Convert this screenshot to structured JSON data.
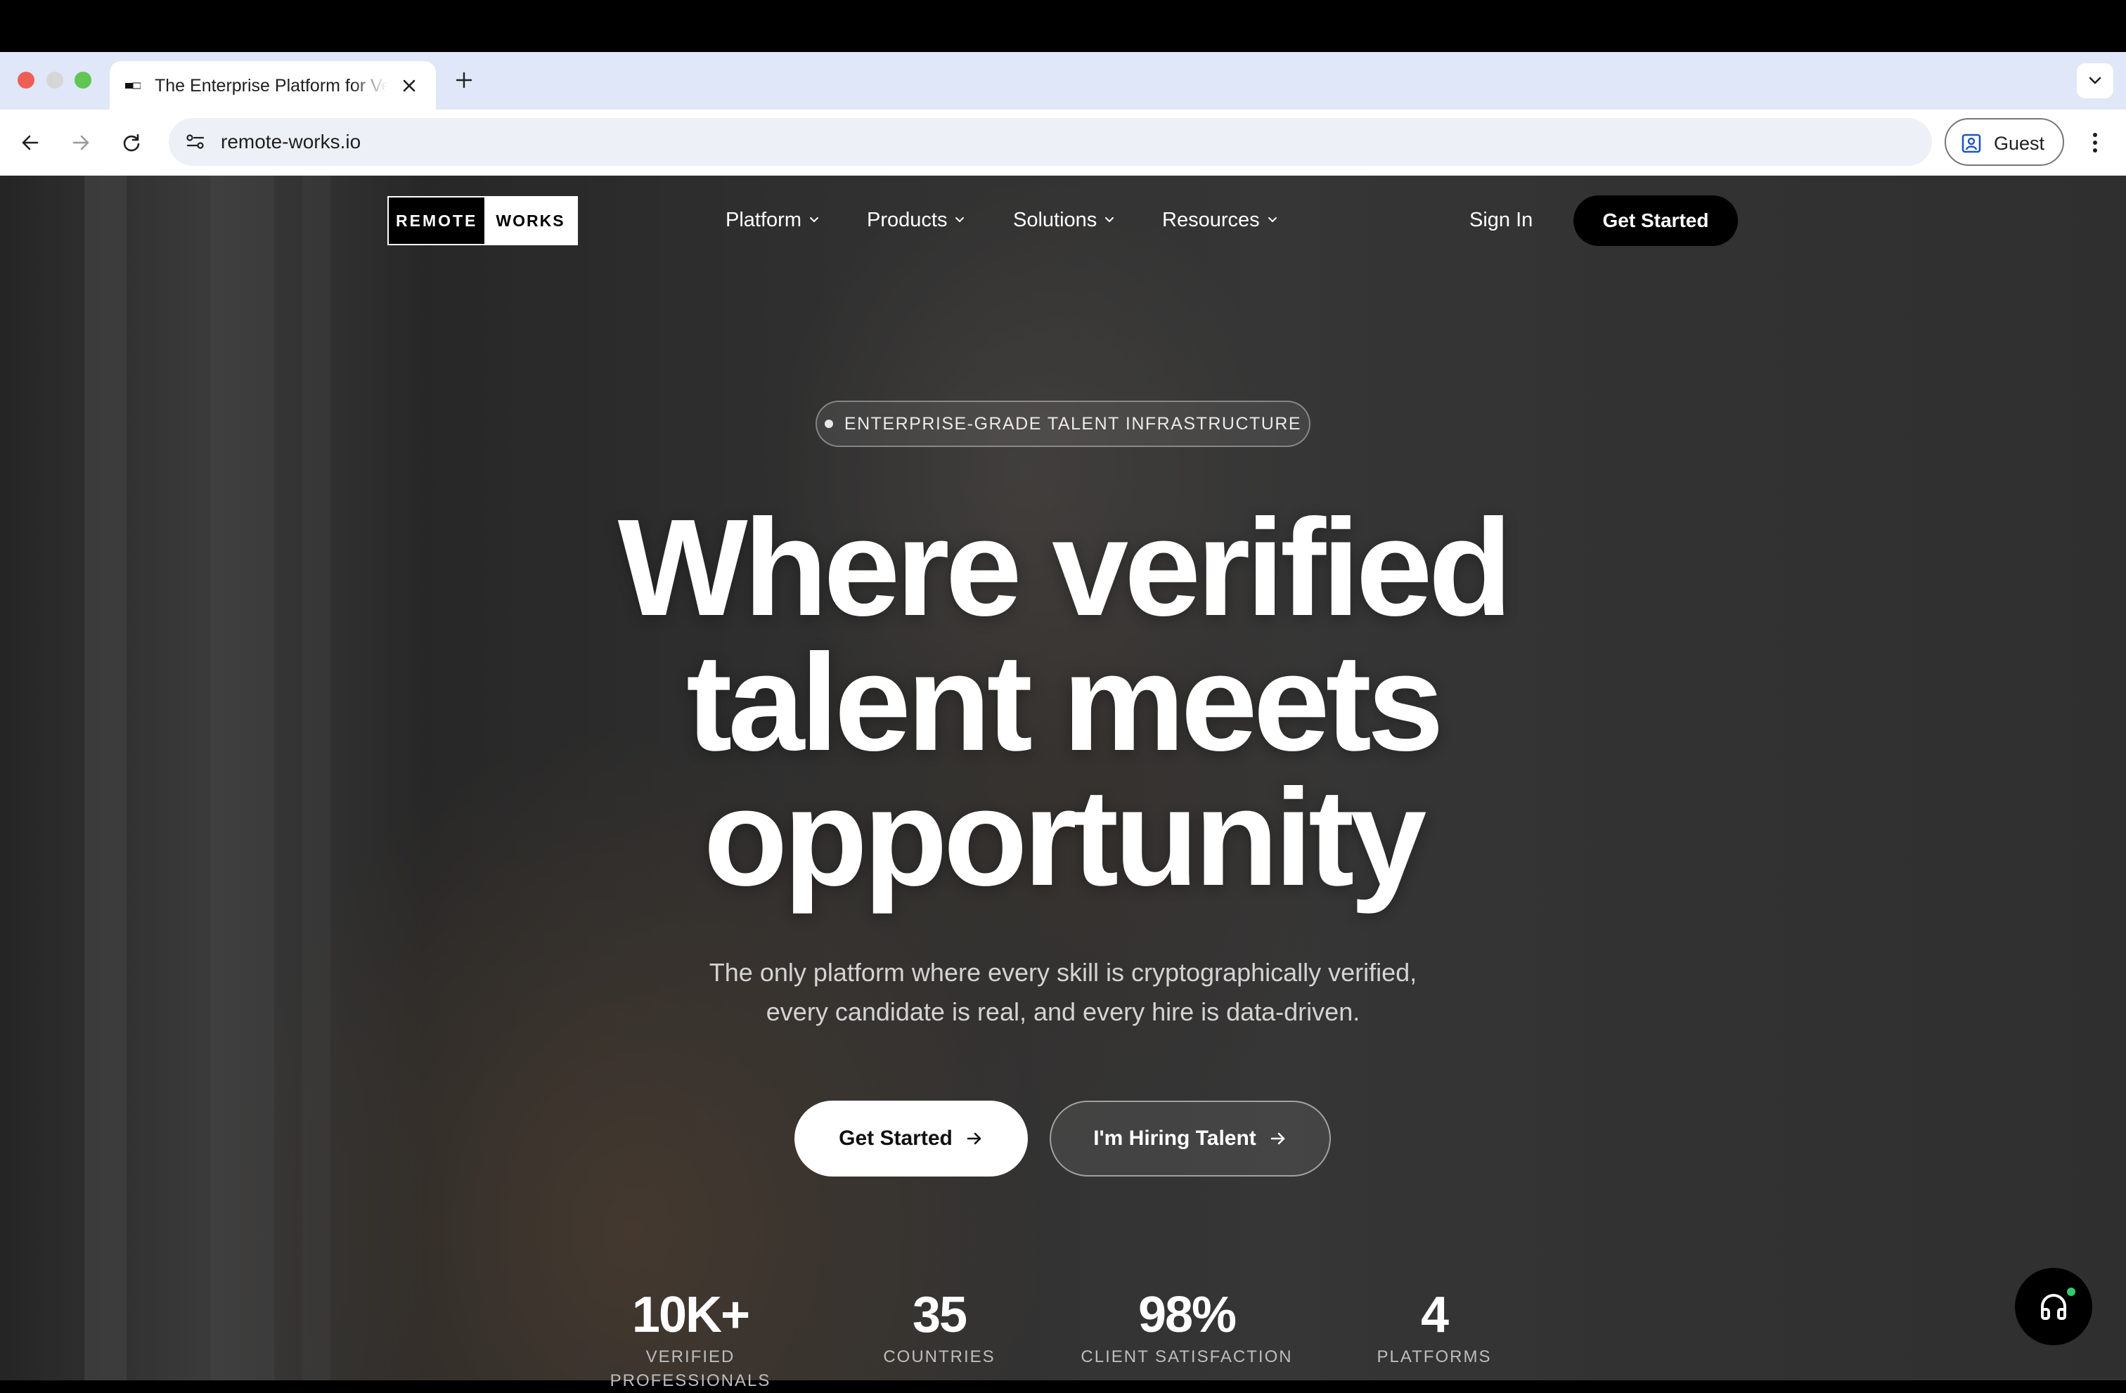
{
  "browser": {
    "tab_title": "The Enterprise Platform for Verified Talent",
    "url": "remote-works.io",
    "profile_label": "Guest"
  },
  "site": {
    "logo": {
      "left": "REMOTE",
      "right": "WORKS"
    },
    "nav": [
      "Platform",
      "Products",
      "Solutions",
      "Resources"
    ],
    "sign_in": "Sign In",
    "get_started": "Get Started"
  },
  "hero": {
    "badge": "ENTERPRISE-GRADE TALENT INFRASTRUCTURE",
    "headline": [
      "Where verified",
      "talent meets",
      "opportunity"
    ],
    "subtitle": [
      "The only platform where every skill is cryptographically verified,",
      "every candidate is real, and every hire is data-driven."
    ],
    "cta_primary": "Get Started",
    "cta_secondary": "I'm Hiring Talent"
  },
  "stats": [
    {
      "value": "10K+",
      "label": "VERIFIED PROFESSIONALS"
    },
    {
      "value": "35",
      "label": "COUNTRIES"
    },
    {
      "value": "98%",
      "label": "CLIENT SATISFACTION"
    },
    {
      "value": "4",
      "label": "PLATFORMS"
    }
  ],
  "colors": {
    "accent": "#000000",
    "online_dot": "#2ecc71"
  }
}
